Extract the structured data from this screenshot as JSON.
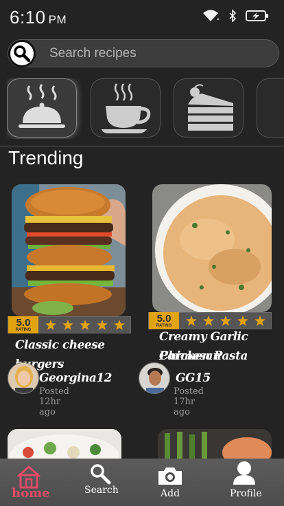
{
  "status_bar": {
    "time": "6:10",
    "ampm": "PM"
  },
  "search": {
    "placeholder": "Search recipes"
  },
  "categories": [
    {
      "icon": "cloche-icon"
    },
    {
      "icon": "coffee-cup-icon"
    },
    {
      "icon": "cake-slice-icon"
    },
    {
      "icon": "category-more-icon"
    }
  ],
  "trending": {
    "title": "Trending",
    "cards": [
      {
        "title_line1": "Classic cheese burgers",
        "title_line2": "",
        "rating": "5.0",
        "rating_label": "RATING",
        "stars": 5,
        "author": "Georgina12",
        "posted": "Posted 12hr ago"
      },
      {
        "title_line1": "Creamy Garlic Parmesan",
        "title_line2": "Chicken Pasta",
        "rating": "5.0",
        "rating_label": "RATING",
        "stars": 5,
        "author": "GG15",
        "posted": "Posted 17hr ago"
      }
    ]
  },
  "nav": {
    "home": "home",
    "search": "Search",
    "add": "Add",
    "profile": "Profile"
  },
  "colors": {
    "accent": "#e84a6a",
    "rating_gold": "#e2a313",
    "background": "#232323"
  }
}
